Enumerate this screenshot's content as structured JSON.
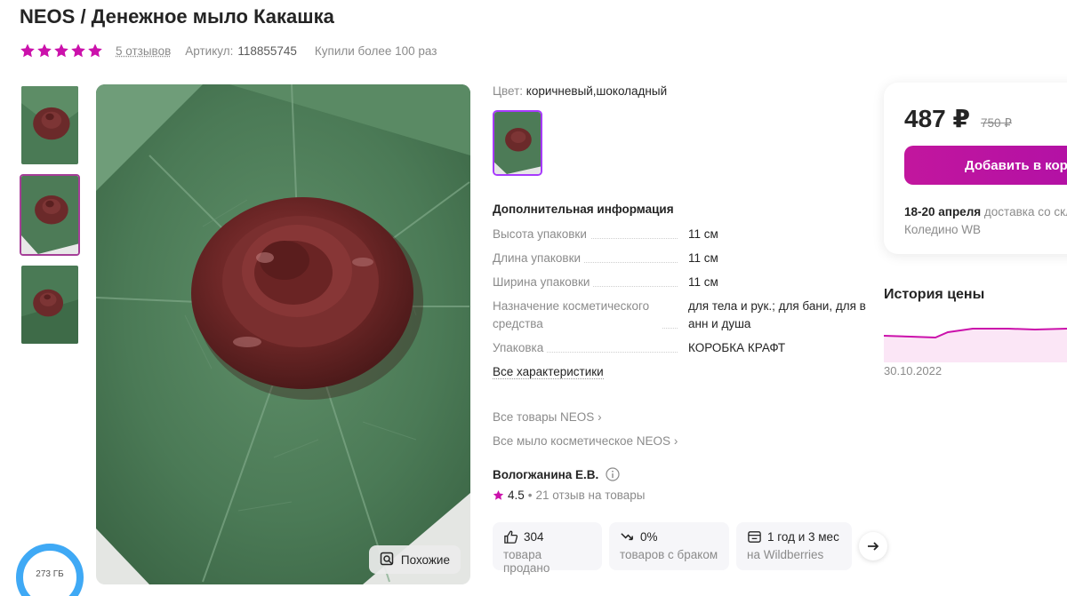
{
  "product": {
    "title": "NEOS / Денежное мыло Какашка",
    "reviews": "5 отзывов",
    "sku_label": "Артикул:",
    "sku_value": "118855745",
    "bought": "Купили более 100 раз",
    "rating_stars": 5
  },
  "gallery": {
    "similar_label": "Похожие"
  },
  "info": {
    "color_label": "Цвет:",
    "color_value": "коричневый,шоколадный",
    "section_title": "Дополнительная информация",
    "specs": [
      {
        "name": "Высота упаковки",
        "value": "11 см"
      },
      {
        "name": "Длина упаковки",
        "value": "11 см"
      },
      {
        "name": "Ширина упаковки",
        "value": "11 см"
      },
      {
        "name": "Назначение косметического средства",
        "value": "для тела и рук.; для бани, для в анн и душа"
      },
      {
        "name": "Упаковка",
        "value": "КОРОБКА КРАФТ"
      }
    ],
    "all_chars": "Все характеристики",
    "brand_links": [
      "Все товары NEOS",
      "Все мыло косметическое NEOS"
    ],
    "seller_name": "Вологжанина Е.В.",
    "seller_rating": "4.5",
    "seller_reviews": "21 отзыв на товары"
  },
  "stats": [
    {
      "value": "304",
      "label": "товара продано",
      "icon": "thumbs-up-icon"
    },
    {
      "value": "0%",
      "label": "товаров с браком",
      "icon": "trend-down-icon"
    },
    {
      "value": "1 год и 3 мес",
      "label": "на Wildberries",
      "icon": "shop-icon"
    }
  ],
  "purchase": {
    "price": "487 ₽",
    "old_price": "750 ₽",
    "cart_label": "Добавить в корзину",
    "delivery_date": "18-20 апреля",
    "delivery_text": "доставка со склада",
    "warehouse": "Коледино WB"
  },
  "history": {
    "title": "История цены",
    "date": "30.10.2022"
  },
  "storage": {
    "label": "273 ГБ"
  },
  "colors": {
    "accent": "#cb11ab",
    "star": "#cb11ab",
    "text": "#242424",
    "muted": "#8b8b8b"
  }
}
